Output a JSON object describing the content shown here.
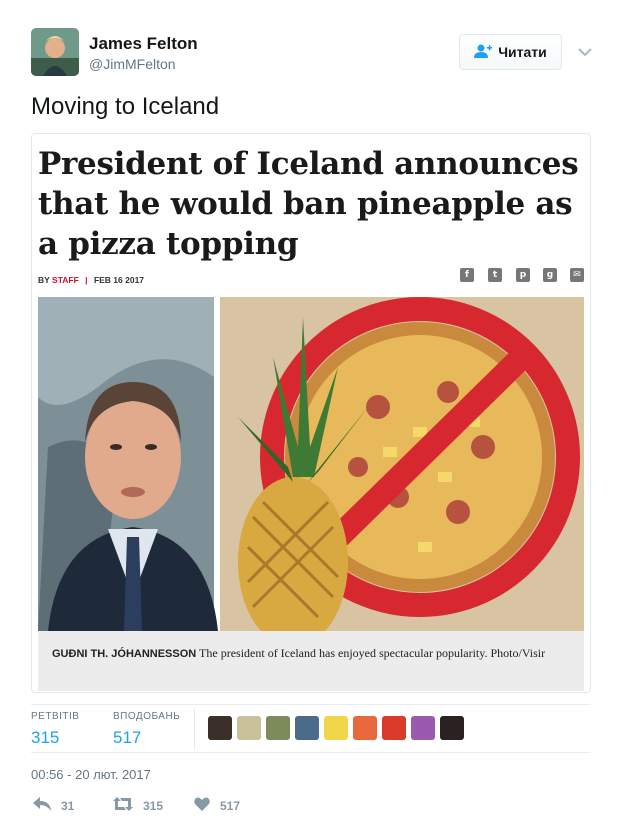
{
  "tweet": {
    "author_name": "James Felton",
    "author_handle": "@JimMFelton",
    "follow_label": "Читати",
    "text": "Moving to Iceland",
    "timestamp": "00:56 - 20 лют. 2017"
  },
  "card": {
    "headline": "President of Iceland announces that he would ban pineapple as a pizza topping",
    "by_prefix": "BY",
    "author": "STAFF",
    "separator": "|",
    "date": "FEB 16 2017",
    "share_icons": [
      "facebook-icon",
      "twitter-icon",
      "pinterest-icon",
      "google-plus-icon",
      "email-icon"
    ],
    "caption_name": "GUÐNI TH. JÓHANNESSON",
    "caption_text": "The president of Iceland has enjoyed spectacular popularity. Photo/Visir"
  },
  "stats": {
    "retweets_label": "РЕТВІТІВ",
    "retweets_value": "315",
    "likes_label": "ВПОДОБАНЬ",
    "likes_value": "517"
  },
  "actions": {
    "reply_count": "31",
    "retweet_count": "315",
    "like_count": "517"
  },
  "colors": {
    "accent": "#1da1f2",
    "muted": "#657786",
    "like_icon": "#8899a6",
    "ban_red": "#d7282f"
  }
}
